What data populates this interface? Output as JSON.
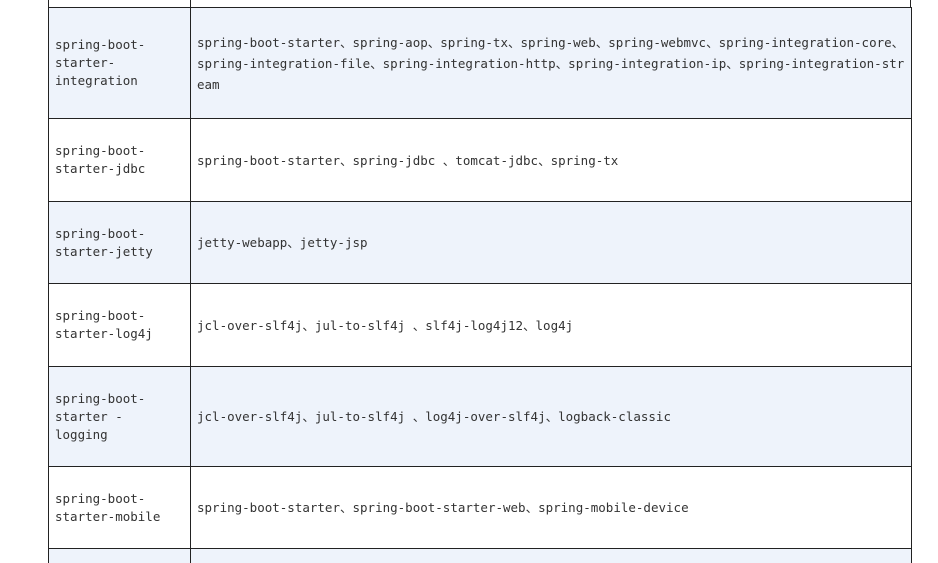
{
  "rows": [
    {
      "name": "spring-boot-starter-integration",
      "name_lines": [
        "spring-boot-",
        "starter-",
        "integration"
      ],
      "dependencies": "spring-boot-starter、spring-aop、spring-tx、spring-web、spring-webmvc、spring-integration-core、spring-integration-file、spring-integration-http、spring-integration-ip、spring-integration-stream"
    },
    {
      "name": "spring-boot-starter-jdbc",
      "name_lines": [
        "spring-boot-",
        "starter-jdbc"
      ],
      "dependencies": "spring-boot-starter、spring-jdbc 、tomcat-jdbc、spring-tx"
    },
    {
      "name": "spring-boot-starter-jetty",
      "name_lines": [
        "spring-boot-",
        "starter-jetty"
      ],
      "dependencies": "jetty-webapp、jetty-jsp"
    },
    {
      "name": "spring-boot-starter-log4j",
      "name_lines": [
        "spring-boot-",
        "starter-log4j"
      ],
      "dependencies": "jcl-over-slf4j、jul-to-slf4j 、slf4j-log4j12、log4j"
    },
    {
      "name": "spring-boot-starter -logging",
      "name_lines": [
        "spring-boot-",
        "starter -",
        "logging"
      ],
      "dependencies": "jcl-over-slf4j、jul-to-slf4j 、log4j-over-slf4j、logback-classic"
    },
    {
      "name": "spring-boot-starter-mobile",
      "name_lines": [
        "spring-boot-",
        "starter-mobile"
      ],
      "dependencies": "spring-boot-starter、spring-boot-starter-web、spring-mobile-device"
    },
    {
      "name": "",
      "name_lines": [],
      "dependencies": ""
    }
  ]
}
